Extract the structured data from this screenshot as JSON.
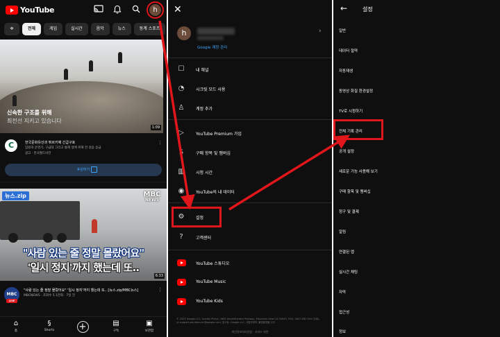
{
  "panel_home": {
    "logo_text": "YouTube",
    "icons": [
      "cast-icon",
      "bell-icon",
      "search-icon"
    ],
    "avatar_initial": "h",
    "chips": [
      "전체",
      "게임",
      "실시간",
      "음악",
      "뉴스",
      "동계 스포츠"
    ],
    "hero": {
      "title": "신속한 구조를 위해",
      "subtitle": "최전선 지키고 있습니다",
      "duration": "1:09"
    },
    "ad": {
      "title": "한국문화유산과 튀르키예 긴급구호",
      "description": "임원과 운영기, 구급대 그리고 통해 생계 위해 한 걸음 응급",
      "meta": "광고 · 한국월드비전",
      "cta": "후원하기"
    },
    "news": {
      "tag": "뉴스.zip",
      "channel_logo_top": "MBC",
      "channel_logo_bottom": "NEWS",
      "caption_line1": "\"사람 있는 줄 정말 몰랐어요\"",
      "caption_line2": "'일시 정지'까지 했는데 또..",
      "duration": "6:33"
    },
    "video_row": {
      "avatar_text": "MBC",
      "live_label": "LIVE",
      "title": "\"사람 있는 줄 정말 몰랐어요\" '일시 정지'까지 했는데 또.. [뉴스.zip/MBC뉴스]",
      "meta": "MBCNEWS · 조회수 5.1만회 · 7일 전"
    },
    "bottom_nav": [
      {
        "label": "홈",
        "icon": "home-icon"
      },
      {
        "label": "Shorts",
        "icon": "shorts-icon"
      },
      {
        "label": "",
        "icon": "create-icon"
      },
      {
        "label": "구독",
        "icon": "subscriptions-icon"
      },
      {
        "label": "보관함",
        "icon": "library-icon"
      }
    ]
  },
  "panel_account": {
    "avatar_initial": "h",
    "google_account_link": "Google 계정 관리",
    "menu_items": [
      {
        "label": "내 채널",
        "icon": "person-icon"
      },
      {
        "label": "시크릿 모드 사용",
        "icon": "incognito-icon"
      },
      {
        "label": "계정 추가",
        "icon": "add-account-icon"
      },
      {
        "label": "YouTube Premium 가입",
        "icon": "premium-icon"
      },
      {
        "label": "구매 항목 및 멤버십",
        "icon": "purchases-icon"
      },
      {
        "label": "시청 시간",
        "icon": "watch-time-icon"
      },
      {
        "label": "YouTube의 내 데이터",
        "icon": "data-icon"
      },
      {
        "label": "설정",
        "icon": "gear-icon"
      },
      {
        "label": "고객센터",
        "icon": "help-icon"
      },
      {
        "label": "YouTube 스튜디오",
        "icon": "studio-icon"
      },
      {
        "label": "YouTube Music",
        "icon": "music-icon"
      },
      {
        "label": "YouTube Kids",
        "icon": "kids-icon"
      }
    ],
    "footer_text": "© 2023 Google LLC, Sundar Pichai, 1600 Amphitheatre Parkway, Mountain View CA 94043, USA, 0807-882-594 (무료), yt-support-solutions-kr@google.com, 호스팅: Google LLC, 사업자정보, 불법촬영물 신고",
    "footer_links": "개인정보처리방침 · 서비스 약관"
  },
  "panel_settings": {
    "title": "설정",
    "items": [
      "일반",
      "데이터 절약",
      "자동재생",
      "동영상 화질 환경설정",
      "TV로 시청하기",
      "전체 기록 관리",
      "공개 설정",
      "새로운 기능 사용해 보기",
      "구매 항목 및 멤버십",
      "청구 및 결제",
      "알림",
      "연결된 앱",
      "실시간 채팅",
      "자막",
      "접근성",
      "정보"
    ]
  },
  "colors": {
    "background": "#0f0f0f",
    "youtube_red": "#ff0000",
    "highlight_red": "#e0161b",
    "link_blue": "#3ea6ff"
  }
}
